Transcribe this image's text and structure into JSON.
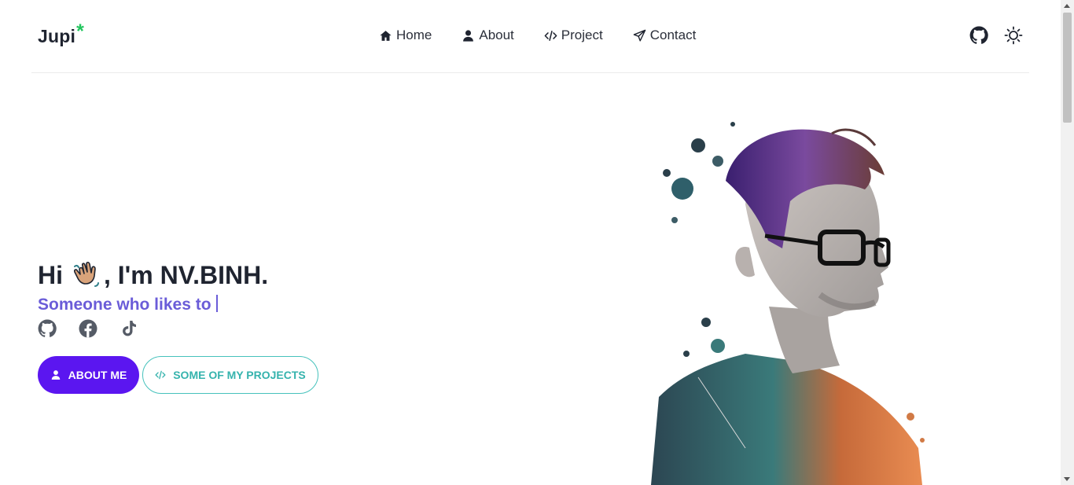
{
  "brand": {
    "name": "Jupi",
    "accent": "*",
    "accent_color": "#22c55e"
  },
  "nav": {
    "items": [
      {
        "label": "Home",
        "icon": "home-icon"
      },
      {
        "label": "About",
        "icon": "user-icon"
      },
      {
        "label": "Project",
        "icon": "code-icon"
      },
      {
        "label": "Contact",
        "icon": "send-icon"
      }
    ]
  },
  "header_icons": {
    "github": "github-icon",
    "theme": "sun-icon"
  },
  "hero": {
    "greeting_prefix": "Hi",
    "greeting_suffix": ", I'm NV.BINH.",
    "subtitle": "Someone who likes to",
    "socials": [
      "github-icon",
      "facebook-icon",
      "tiktok-icon"
    ],
    "primary_button": "About me",
    "secondary_button": "Some of my projects"
  },
  "colors": {
    "primary": "#5b16f0",
    "teal": "#35b3ad",
    "subtitle": "#6a5cd8"
  }
}
